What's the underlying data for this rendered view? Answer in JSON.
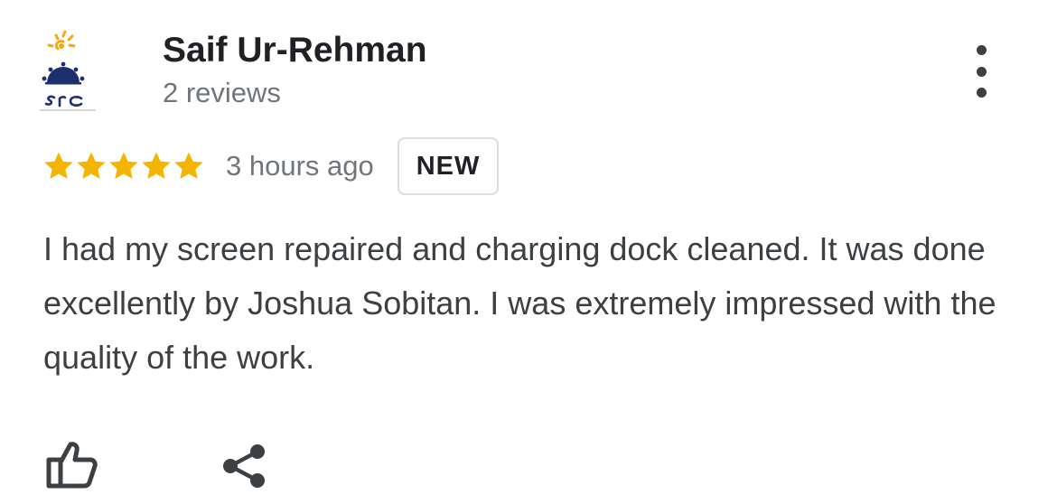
{
  "review": {
    "avatar_icon": "business-logo-avatar",
    "avatar_logo_text": "SRC",
    "reviewer_name": "Saif Ur-Rehman",
    "reviewer_meta": "2 reviews",
    "rating": 5,
    "rating_max": 5,
    "time": "3 hours ago",
    "badge": "NEW",
    "text": "I had my screen repaired and charging dock cleaned. It was done excellently by Joshua Sobitan. I was extremely impressed with the quality of the work."
  },
  "icons": {
    "more": "more-vertical-icon",
    "star": "star-icon",
    "like": "thumbs-up-icon",
    "share": "share-icon"
  },
  "colors": {
    "star": "#F4B400",
    "name": "#202124",
    "meta": "#70757A",
    "body_text": "#3C4043",
    "badge_border": "#DADCE0",
    "logo_navy": "#1D2F6F",
    "logo_orange": "#F3A712"
  }
}
